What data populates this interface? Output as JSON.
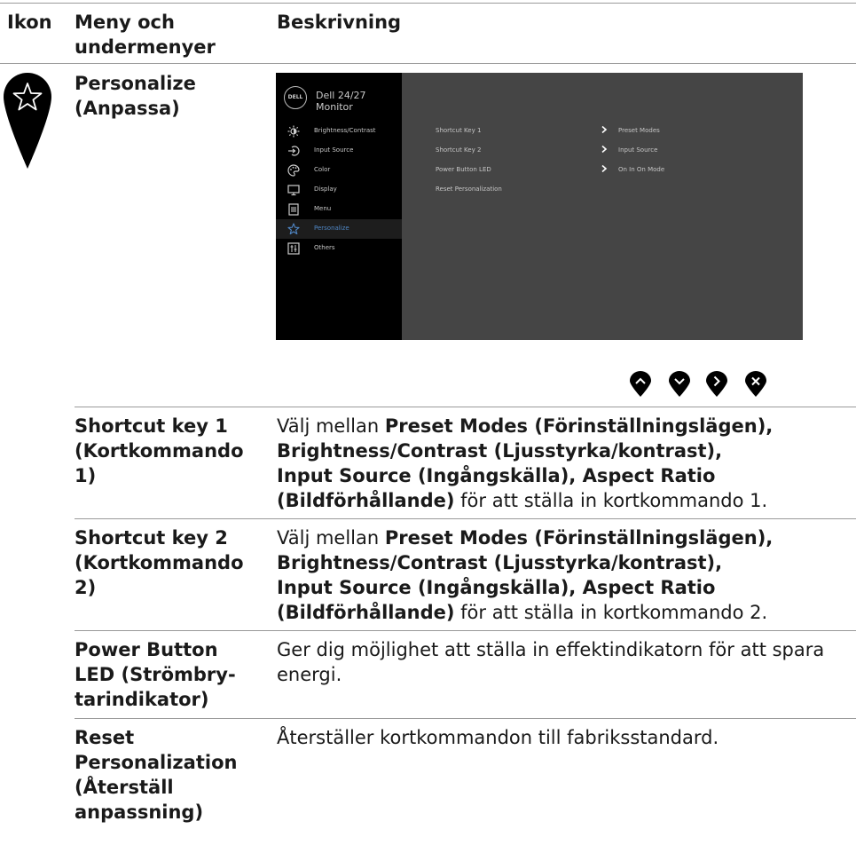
{
  "header": {
    "col_icon": "Ikon",
    "col_menu_line1": "Meny och",
    "col_menu_line2": "undermenyer",
    "col_desc": "Beskrivning"
  },
  "personalize": {
    "menu_line1": "Personalize",
    "menu_line2": "(Anpassa)",
    "icon": "star-icon"
  },
  "osd": {
    "logo": "DELL",
    "title": "Dell 24/27 Monitor",
    "menu": [
      {
        "label": "Brightness/Contrast",
        "icon": "brightness-icon"
      },
      {
        "label": "Input Source",
        "icon": "input-source-icon"
      },
      {
        "label": "Color",
        "icon": "color-icon"
      },
      {
        "label": "Display",
        "icon": "display-icon"
      },
      {
        "label": "Menu",
        "icon": "menu-icon"
      },
      {
        "label": "Personalize",
        "icon": "star-icon",
        "selected": true
      },
      {
        "label": "Others",
        "icon": "others-icon"
      }
    ],
    "rows": [
      {
        "label": "Shortcut Key 1",
        "value": "Preset Modes"
      },
      {
        "label": "Shortcut Key 2",
        "value": "Input Source"
      },
      {
        "label": "Power Button LED",
        "value": "On In On Mode"
      },
      {
        "label": "Reset Personalization",
        "value": ""
      }
    ],
    "colors": {
      "panel": "#454545",
      "sidebar": "#000000",
      "selected_text": "#4f86c4"
    }
  },
  "nav_buttons": [
    "up-icon",
    "down-icon",
    "right-icon",
    "close-icon"
  ],
  "rows": [
    {
      "menu": [
        "Shortcut key 1",
        "(Kortkommando",
        "1)"
      ],
      "desc": [
        {
          "pre": "Välj mellan ",
          "b": "Preset Modes (Förinställningslägen),"
        },
        {
          "pre": "",
          "b": "Brightness/Contrast (Ljusstyrka/kontrast),"
        },
        {
          "pre": "",
          "b": "Input Source (Ingångskälla), Aspect Ratio"
        },
        {
          "pre": "",
          "b": "(Bildförhållande)",
          "post": " för att ställa in kortkommando 1."
        }
      ]
    },
    {
      "menu": [
        "Shortcut key 2",
        "(Kortkommando",
        "2)"
      ],
      "desc": [
        {
          "pre": "Välj mellan ",
          "b": "Preset Modes (Förinställningslägen),"
        },
        {
          "pre": "",
          "b": "Brightness/Contrast (Ljusstyrka/kontrast),"
        },
        {
          "pre": "",
          "b": "Input Source (Ingångskälla), Aspect Ratio"
        },
        {
          "pre": "",
          "b": "(Bildförhållande)",
          "post": " för att ställa in kortkommando 2."
        }
      ]
    },
    {
      "menu": [
        "Power Button",
        "LED (Strömbry-",
        "tarindikator)"
      ],
      "desc_plain": [
        "Ger dig möjlighet att ställa in effektindikatorn för att spara",
        "energi."
      ]
    },
    {
      "menu": [
        "Reset",
        "Personalization",
        "(Återställ",
        "anpassning)"
      ],
      "desc_plain": [
        "Återställer kortkommandon till fabriksstandard."
      ]
    }
  ]
}
